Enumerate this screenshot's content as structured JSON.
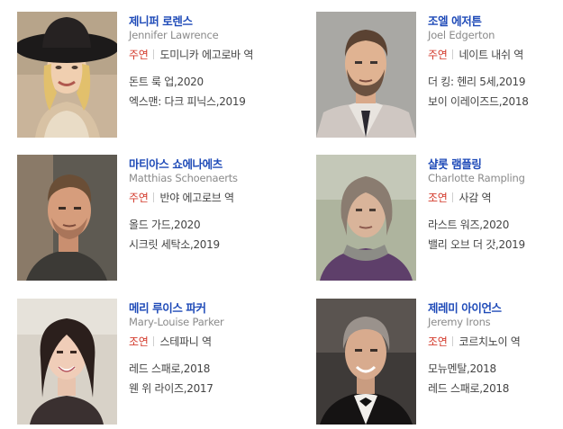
{
  "cast": [
    {
      "name_ko": "제니퍼 로렌스",
      "name_en": "Jennifer Lawrence",
      "role_type": "주연",
      "character": "도미니카 에고로바 역",
      "films": [
        "돈트 룩 업,2020",
        "엑스맨: 다크 피닉스,2019"
      ],
      "photo_icon": "portrait-woman-black-hat"
    },
    {
      "name_ko": "조엘 에저튼",
      "name_en": "Joel Edgerton",
      "role_type": "주연",
      "character": "네이트 내쉬 역",
      "films": [
        "더 킹: 헨리 5세,2019",
        "보이 이레이즈드,2018"
      ],
      "photo_icon": "portrait-man-beard"
    },
    {
      "name_ko": "마티아스 쇼에나에츠",
      "name_en": "Matthias Schoenaerts",
      "role_type": "주연",
      "character": "반야 에고로브 역",
      "films": [
        "올드 가드,2020",
        "시크릿 세탁소,2019"
      ],
      "photo_icon": "portrait-man-stubble"
    },
    {
      "name_ko": "샬롯 램플링",
      "name_en": "Charlotte Rampling",
      "role_type": "조연",
      "character": "사감 역",
      "films": [
        "라스트 워즈,2020",
        "밸리 오브 더 갓,2019"
      ],
      "photo_icon": "portrait-woman-gray-hair"
    },
    {
      "name_ko": "메리 루이스 파커",
      "name_en": "Mary-Louise Parker",
      "role_type": "조연",
      "character": "스테파니 역",
      "films": [
        "레드 스패로,2018",
        "웬 위 라이즈,2017"
      ],
      "photo_icon": "portrait-woman-dark-hair"
    },
    {
      "name_ko": "제레미 아이언스",
      "name_en": "Jeremy Irons",
      "role_type": "조연",
      "character": "코르치노이 역",
      "films": [
        "모뉴멘탈,2018",
        "레드 스패로,2018"
      ],
      "photo_icon": "portrait-man-gray-hair"
    }
  ],
  "colors": {
    "name": "#1f4bb8",
    "role_type": "#d33a2c",
    "english_name": "#8a8a8a"
  }
}
